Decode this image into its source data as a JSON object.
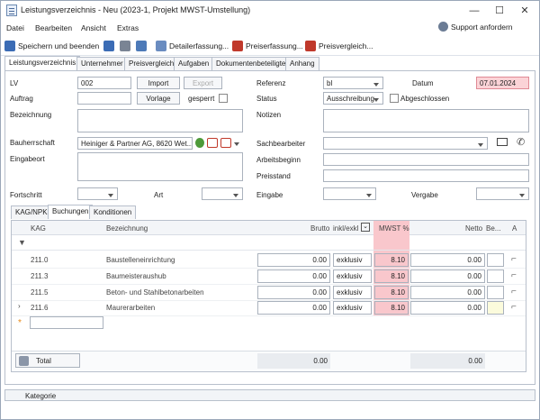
{
  "window": {
    "title": "Leistungsverzeichnis - Neu (2023-1, Projekt MWST-Umstellung)"
  },
  "menu": [
    "Datei",
    "Bearbeiten",
    "Ansicht",
    "Extras"
  ],
  "support": "Support anfordern",
  "toolbar": {
    "save_close": "Speichern und beenden",
    "detail": "Detailerfassung...",
    "price": "Preiserfassung...",
    "compare": "Preisvergleich..."
  },
  "tabs": [
    "Leistungsverzeichnis",
    "Unternehmer",
    "Preisvergleich",
    "Aufgaben",
    "Dokumentenbeteiligte",
    "Anhang"
  ],
  "form": {
    "lv_label": "LV",
    "lv_value": "002",
    "import": "Import",
    "export": "Export",
    "auftrag_label": "Auftrag",
    "vorlage": "Vorlage",
    "gesperrt": "gesperrt",
    "bezeichnung_label": "Bezeichnung",
    "bauherr_label": "Bauherrschaft",
    "bauherr_value": "Heiniger & Partner AG, 8620 Wet...",
    "eingabeort_label": "Eingabeort",
    "fortschritt_label": "Fortschritt",
    "art_label": "Art",
    "referenz_label": "Referenz",
    "referenz_value": "bl",
    "datum_label": "Datum",
    "datum_value": "07.01.2024",
    "status_label": "Status",
    "status_value": "Ausschreibung",
    "abgeschlossen": "Abgeschlossen",
    "notizen_label": "Notizen",
    "sachbearbeiter_label": "Sachbearbeiter",
    "arbeitsbeginn_label": "Arbeitsbeginn",
    "preisstand_label": "Preisstand",
    "eingabe_label": "Eingabe",
    "vergabe_label": "Vergabe"
  },
  "subtabs": [
    "KAG/NPK",
    "Buchungen",
    "Konditionen"
  ],
  "grid": {
    "headers": {
      "kag": "KAG",
      "bez": "Bezeichnung",
      "brutto": "Brutto",
      "inkl": "inkl/exkl",
      "mwst": "MWST %",
      "netto": "Netto",
      "be": "Be...",
      "a": "A"
    },
    "rows": [
      {
        "kag": "211.0",
        "bez": "Baustelleneinrichtung",
        "brutto": "0.00",
        "inkl": "exklusiv",
        "mwst": "8.10",
        "netto": "0.00"
      },
      {
        "kag": "211.3",
        "bez": "Baumeisteraushub",
        "brutto": "0.00",
        "inkl": "exklusiv",
        "mwst": "8.10",
        "netto": "0.00"
      },
      {
        "kag": "211.5",
        "bez": "Beton- und Stahlbetonarbeiten",
        "brutto": "0.00",
        "inkl": "exklusiv",
        "mwst": "8.10",
        "netto": "0.00"
      },
      {
        "kag": "211.6",
        "bez": "Maurerarbeiten",
        "brutto": "0.00",
        "inkl": "exklusiv",
        "mwst": "8.10",
        "netto": "0.00"
      }
    ],
    "total_label": "Total",
    "total_brutto": "0.00",
    "total_netto": "0.00"
  },
  "status_bar": "Kategorie",
  "colors": {
    "accent_red": "#f9c7cc",
    "border": "#aab2bd"
  }
}
